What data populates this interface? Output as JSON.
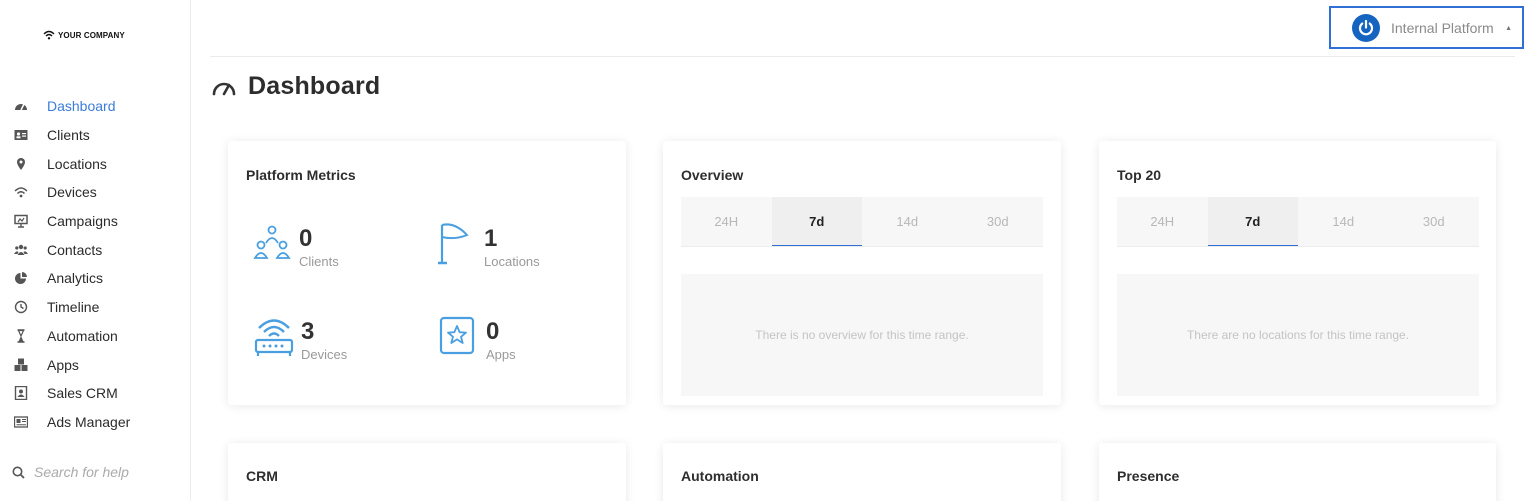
{
  "logo": {
    "text": "YOUR COMPANY"
  },
  "sidebar": {
    "items": [
      {
        "label": "Dashboard",
        "icon": "dashboard-icon",
        "active": true
      },
      {
        "label": "Clients",
        "icon": "id-card-icon"
      },
      {
        "label": "Locations",
        "icon": "map-pin-icon"
      },
      {
        "label": "Devices",
        "icon": "wifi-icon"
      },
      {
        "label": "Campaigns",
        "icon": "presentation-icon"
      },
      {
        "label": "Contacts",
        "icon": "users-icon"
      },
      {
        "label": "Analytics",
        "icon": "pie-chart-icon"
      },
      {
        "label": "Timeline",
        "icon": "clock-icon"
      },
      {
        "label": "Automation",
        "icon": "hourglass-icon"
      },
      {
        "label": "Apps",
        "icon": "cubes-icon"
      },
      {
        "label": "Sales CRM",
        "icon": "contact-book-icon"
      },
      {
        "label": "Ads Manager",
        "icon": "newspaper-icon"
      }
    ],
    "search_placeholder": "Search for help"
  },
  "header": {
    "platform": "Internal Platform"
  },
  "page": {
    "title": "Dashboard"
  },
  "cards": {
    "metrics": {
      "title": "Platform Metrics",
      "items": [
        {
          "value": "0",
          "label": "Clients",
          "icon": "people-network-icon"
        },
        {
          "value": "1",
          "label": "Locations",
          "icon": "flag-icon"
        },
        {
          "value": "3",
          "label": "Devices",
          "icon": "router-icon"
        },
        {
          "value": "0",
          "label": "Apps",
          "icon": "star-box-icon"
        }
      ]
    },
    "overview": {
      "title": "Overview",
      "tabs": [
        "24H",
        "7d",
        "14d",
        "30d"
      ],
      "active_tab": "7d",
      "empty_text": "There is no overview for this time range."
    },
    "top20": {
      "title": "Top 20",
      "tabs": [
        "24H",
        "7d",
        "14d",
        "30d"
      ],
      "active_tab": "7d",
      "empty_text": "There are no locations for this time range."
    },
    "crm": {
      "title": "CRM"
    },
    "automation": {
      "title": "Automation"
    },
    "presence": {
      "title": "Presence"
    }
  },
  "colors": {
    "accent": "#3b7dd8",
    "icon_blue": "#4a9fe0",
    "select_border": "#2f6fd6",
    "power_bg": "#1565c0"
  }
}
